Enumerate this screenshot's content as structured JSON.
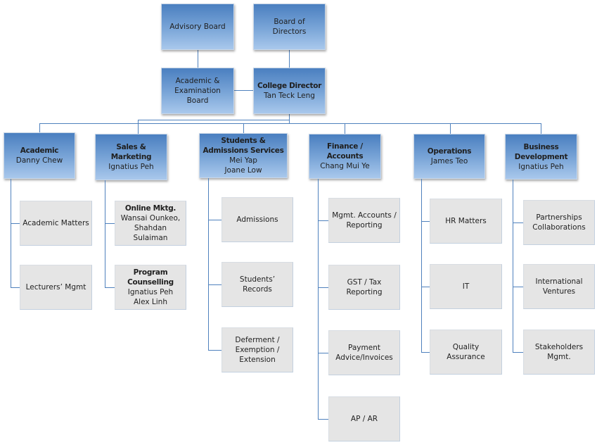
{
  "colors": {
    "connector": "#4f81bd",
    "header_top": "#4a7fc0",
    "header_bottom": "#a9c8ec",
    "child_fill": "#e5e5e5"
  },
  "governance": {
    "advisory_board": "Advisory Board",
    "board_of_directors": "Board of Directors",
    "academic_exam_board": [
      "Academic &",
      "Examination",
      "Board"
    ],
    "college_director": {
      "title": "College Director",
      "name": "Tan Teck Leng"
    }
  },
  "departments": [
    {
      "title": [
        "Academic"
      ],
      "people": [
        "Danny Chew"
      ],
      "children": [
        {
          "lines": [
            "Academic Matters"
          ]
        },
        {
          "lines": [
            "Lecturers’ Mgmt"
          ]
        }
      ]
    },
    {
      "title": [
        "Sales & Marketing"
      ],
      "people": [
        "Ignatius Peh"
      ],
      "children": [
        {
          "title": [
            "Online Mktg."
          ],
          "lines": [
            "Wansai Ounkeo,",
            "Shahdan Sulaiman"
          ]
        },
        {
          "title": [
            "Program",
            "Counselling"
          ],
          "lines": [
            "Ignatius Peh",
            "Alex Linh"
          ]
        }
      ]
    },
    {
      "title": [
        "Students &",
        "Admissions Services"
      ],
      "people": [
        "Mei Yap",
        "Joane Low"
      ],
      "children": [
        {
          "lines": [
            "Admissions"
          ]
        },
        {
          "lines": [
            "Students’",
            "Records"
          ]
        },
        {
          "lines": [
            "Deferment /",
            "Exemption /",
            "Extension"
          ]
        }
      ]
    },
    {
      "title": [
        "Finance / Accounts"
      ],
      "people": [
        "Chang Mui Ye"
      ],
      "children": [
        {
          "lines": [
            "Mgmt. Accounts /",
            "Reporting"
          ]
        },
        {
          "lines": [
            "GST / Tax",
            "Reporting"
          ]
        },
        {
          "lines": [
            "Payment",
            "Advice/Invoices"
          ]
        },
        {
          "lines": [
            "AP / AR"
          ]
        }
      ]
    },
    {
      "title": [
        "Operations"
      ],
      "people": [
        "James Teo"
      ],
      "children": [
        {
          "lines": [
            "HR Matters"
          ]
        },
        {
          "lines": [
            "IT"
          ]
        },
        {
          "lines": [
            "Quality Assurance"
          ]
        }
      ]
    },
    {
      "title": [
        "Business",
        "Development"
      ],
      "people": [
        "Ignatius Peh"
      ],
      "children": [
        {
          "lines": [
            "Partnerships",
            "Collaborations"
          ]
        },
        {
          "lines": [
            "International",
            "Ventures"
          ]
        },
        {
          "lines": [
            "Stakeholders",
            "Mgmt."
          ]
        }
      ]
    }
  ]
}
